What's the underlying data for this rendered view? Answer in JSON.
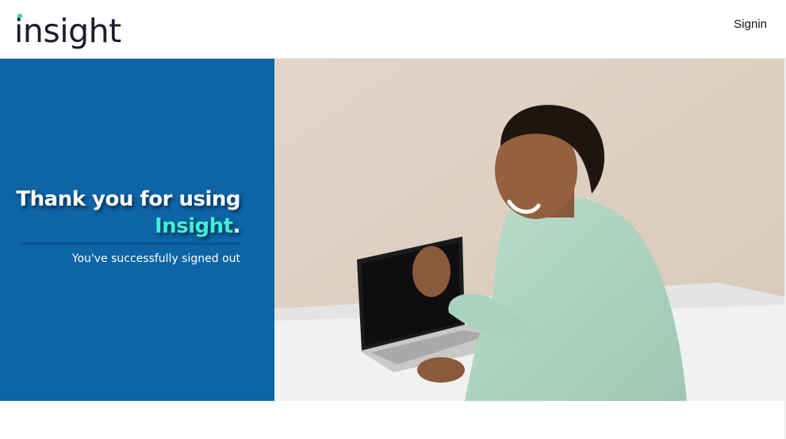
{
  "header": {
    "logo_text": "insight",
    "signin_label": "Signin"
  },
  "panel": {
    "thanks_line1": "Thank you for using",
    "brand": "Insight",
    "period": ".",
    "subtext": "You've successfully signed out"
  },
  "colors": {
    "panel_blue": "#0d64a6",
    "brand_teal": "#3ff0d2",
    "logo_accent": "#2ad6c0"
  },
  "hero": {
    "image": "woman-using-laptop-photo"
  }
}
